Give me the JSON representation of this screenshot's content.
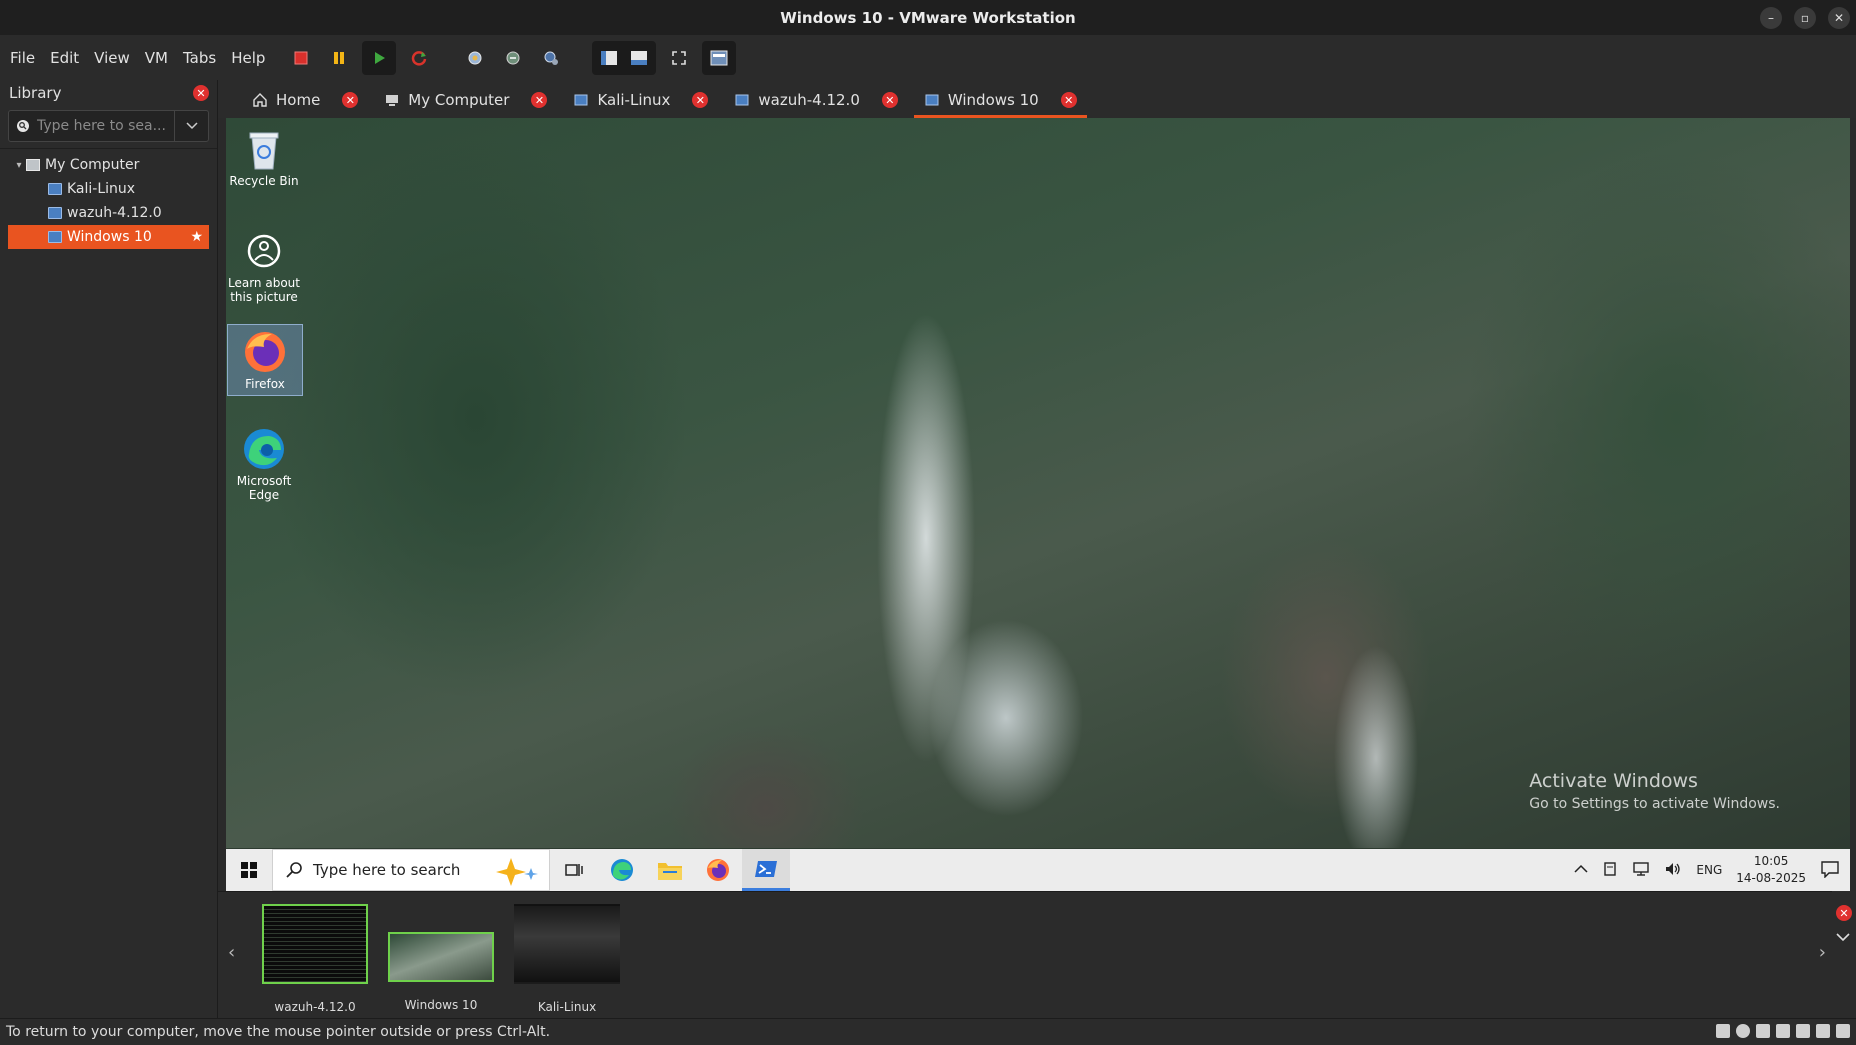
{
  "window": {
    "title": "Windows 10 - VMware Workstation"
  },
  "menu": [
    "File",
    "Edit",
    "View",
    "VM",
    "Tabs",
    "Help"
  ],
  "library": {
    "title": "Library",
    "search_placeholder": "Type here to sea...",
    "tree": {
      "root": "My Computer",
      "items": [
        "Kali-Linux",
        "wazuh-4.12.0",
        "Windows 10"
      ],
      "selected": "Windows 10"
    }
  },
  "tabs": [
    {
      "label": "Home",
      "icon": "home-icon"
    },
    {
      "label": "My Computer",
      "icon": "computer-icon"
    },
    {
      "label": "Kali-Linux",
      "icon": "vm-icon"
    },
    {
      "label": "wazuh-4.12.0",
      "icon": "vm-icon"
    },
    {
      "label": "Windows 10",
      "icon": "vm-icon",
      "active": true
    }
  ],
  "desktop": {
    "icons": [
      {
        "label": "Recycle Bin"
      },
      {
        "label": "Learn about this picture"
      },
      {
        "label": "Firefox"
      },
      {
        "label": "Microsoft Edge"
      }
    ],
    "watermark": {
      "line1": "Activate Windows",
      "line2": "Go to Settings to activate Windows."
    }
  },
  "taskbar": {
    "search_placeholder": "Type here to search",
    "tray": {
      "lang": "ENG",
      "time": "10:05",
      "date": "14-08-2025"
    }
  },
  "thumbnails": [
    {
      "label": "wazuh-4.12.0"
    },
    {
      "label": "Windows 10"
    },
    {
      "label": "Kali-Linux"
    }
  ],
  "status": {
    "message": "To return to your computer, move the mouse pointer outside or press Ctrl-Alt."
  },
  "colors": {
    "accent": "#e95420",
    "close": "#e0312f"
  }
}
